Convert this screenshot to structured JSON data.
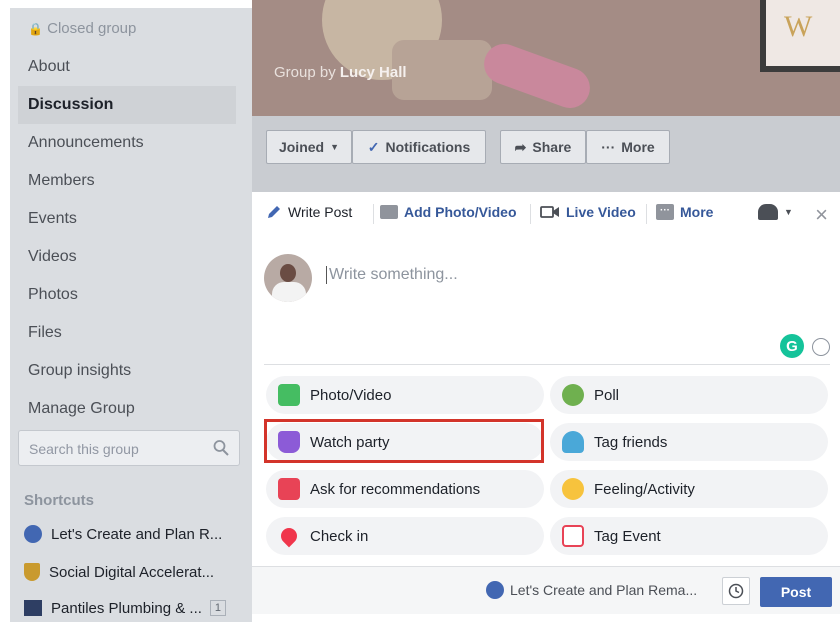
{
  "sidebar": {
    "closed_group": "Closed group",
    "nav": [
      "About",
      "Discussion",
      "Announcements",
      "Members",
      "Events",
      "Videos",
      "Photos",
      "Files",
      "Group insights",
      "Manage Group"
    ],
    "active_nav": "Discussion",
    "search_placeholder": "Search this group",
    "shortcuts_heading": "Shortcuts",
    "shortcuts": [
      {
        "label": "Let's Create and Plan R...",
        "icon": "group-icon"
      },
      {
        "label": "Social Digital Accelerat...",
        "icon": "trophy-icon"
      },
      {
        "label": "Pantiles Plumbing & ...",
        "icon": "page-icon",
        "badge": "1"
      }
    ]
  },
  "cover": {
    "group_by_prefix": "Group by",
    "owner": "Lucy Hall",
    "frame_text": "W"
  },
  "actions": {
    "joined": "Joined",
    "notifications": "Notifications",
    "share": "Share",
    "more": "More"
  },
  "composer": {
    "tabs": {
      "write_post": "Write Post",
      "add_photo": "Add Photo/Video",
      "live_video": "Live Video",
      "more": "More"
    },
    "placeholder": "Write something...",
    "grammarly": "G",
    "options": [
      {
        "label": "Photo/Video",
        "icon": "photo-icon",
        "color": "#45bd62"
      },
      {
        "label": "Poll",
        "icon": "poll-icon",
        "color": "#6fb04f"
      },
      {
        "label": "Watch party",
        "icon": "watch-party-icon",
        "color": "#8c5bd7"
      },
      {
        "label": "Tag friends",
        "icon": "tag-friends-icon",
        "color": "#4aa8d8"
      },
      {
        "label": "Ask for recommendations",
        "icon": "recommendations-icon",
        "color": "#e84356"
      },
      {
        "label": "Feeling/Activity",
        "icon": "feeling-icon",
        "color": "#f7c33d"
      },
      {
        "label": "Check in",
        "icon": "check-in-icon",
        "color": "#f0364c"
      },
      {
        "label": "Tag Event",
        "icon": "event-icon",
        "color": "#e84356"
      }
    ],
    "footer": {
      "audience": "Let's Create and Plan Rema...",
      "post": "Post"
    }
  }
}
